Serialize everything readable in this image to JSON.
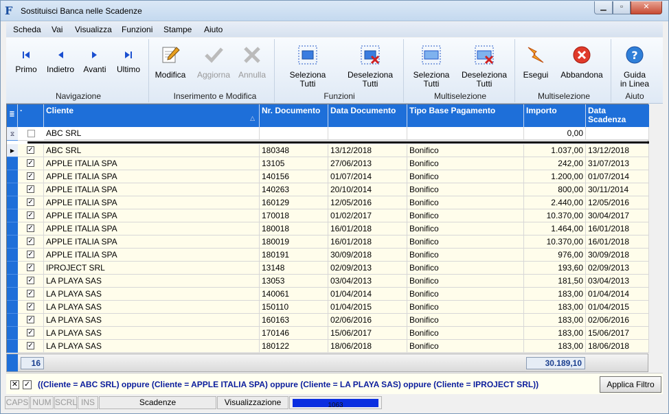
{
  "window": {
    "title": "Sostituisci Banca nelle Scadenze",
    "icon_letter": "F"
  },
  "menu": [
    "Scheda",
    "Vai",
    "Visualizza",
    "Funzioni",
    "Stampe",
    "Aiuto"
  ],
  "toolbar": {
    "nav": {
      "first": "Primo",
      "prev": "Indietro",
      "next": "Avanti",
      "last": "Ultimo",
      "group": "Navigazione"
    },
    "edit": {
      "modify": "Modifica",
      "update": "Aggiorna",
      "cancel": "Annulla",
      "group": "Inserimento e Modifica"
    },
    "funcs": {
      "select_all_1": "Seleziona",
      "select_all_2": "Tutti",
      "deselect_all_1": "Deseleziona",
      "deselect_all_2": "Tutti",
      "group": "Funzioni"
    },
    "multi": {
      "select_all_1": "Seleziona",
      "select_all_2": "Tutti",
      "deselect_all_1": "Deseleziona",
      "deselect_all_2": "Tutti",
      "group": "Multiselezione"
    },
    "exec": {
      "run": "Esegui",
      "abort": "Abbandona",
      "group": "Multiselezione"
    },
    "help": {
      "label_1": "Guida",
      "label_2": "in Linea",
      "group": "Aiuto"
    }
  },
  "grid": {
    "headers": {
      "check": "·",
      "cliente": "Cliente",
      "nr_doc": "Nr. Documento",
      "data_doc": "Data Documento",
      "tipo": "Tipo Base Pagamento",
      "importo": "Importo",
      "scadenza_1": "Data",
      "scadenza_2": "Scadenza"
    },
    "filter_row": {
      "cliente": "ABC SRL",
      "importo": "0,00"
    },
    "rows": [
      {
        "cliente": "ABC SRL",
        "nr": "180348",
        "data": "13/12/2018",
        "tipo": "Bonifico",
        "importo": "1.037,00",
        "scadenza": "13/12/2018"
      },
      {
        "cliente": "APPLE ITALIA SPA",
        "nr": "13105",
        "data": "27/06/2013",
        "tipo": "Bonifico",
        "importo": "242,00",
        "scadenza": "31/07/2013"
      },
      {
        "cliente": "APPLE ITALIA SPA",
        "nr": "140156",
        "data": "01/07/2014",
        "tipo": "Bonifico",
        "importo": "1.200,00",
        "scadenza": "01/07/2014"
      },
      {
        "cliente": "APPLE ITALIA SPA",
        "nr": "140263",
        "data": "20/10/2014",
        "tipo": "Bonifico",
        "importo": "800,00",
        "scadenza": "30/11/2014"
      },
      {
        "cliente": "APPLE ITALIA SPA",
        "nr": "160129",
        "data": "12/05/2016",
        "tipo": "Bonifico",
        "importo": "2.440,00",
        "scadenza": "12/05/2016"
      },
      {
        "cliente": "APPLE ITALIA SPA",
        "nr": "170018",
        "data": "01/02/2017",
        "tipo": "Bonifico",
        "importo": "10.370,00",
        "scadenza": "30/04/2017"
      },
      {
        "cliente": "APPLE ITALIA SPA",
        "nr": "180018",
        "data": "16/01/2018",
        "tipo": "Bonifico",
        "importo": "1.464,00",
        "scadenza": "16/01/2018"
      },
      {
        "cliente": "APPLE ITALIA SPA",
        "nr": "180019",
        "data": "16/01/2018",
        "tipo": "Bonifico",
        "importo": "10.370,00",
        "scadenza": "16/01/2018"
      },
      {
        "cliente": "APPLE ITALIA SPA",
        "nr": "180191",
        "data": "30/09/2018",
        "tipo": "Bonifico",
        "importo": "976,00",
        "scadenza": "30/09/2018"
      },
      {
        "cliente": "IPROJECT SRL",
        "nr": "13148",
        "data": "02/09/2013",
        "tipo": "Bonifico",
        "importo": "193,60",
        "scadenza": "02/09/2013"
      },
      {
        "cliente": "LA PLAYA SAS",
        "nr": "13053",
        "data": "03/04/2013",
        "tipo": "Bonifico",
        "importo": "181,50",
        "scadenza": "03/04/2013"
      },
      {
        "cliente": "LA PLAYA SAS",
        "nr": "140061",
        "data": "01/04/2014",
        "tipo": "Bonifico",
        "importo": "183,00",
        "scadenza": "01/04/2014"
      },
      {
        "cliente": "LA PLAYA SAS",
        "nr": "150110",
        "data": "01/04/2015",
        "tipo": "Bonifico",
        "importo": "183,00",
        "scadenza": "01/04/2015"
      },
      {
        "cliente": "LA PLAYA SAS",
        "nr": "160163",
        "data": "02/06/2016",
        "tipo": "Bonifico",
        "importo": "183,00",
        "scadenza": "02/06/2016"
      },
      {
        "cliente": "LA PLAYA SAS",
        "nr": "170146",
        "data": "15/06/2017",
        "tipo": "Bonifico",
        "importo": "183,00",
        "scadenza": "15/06/2017"
      },
      {
        "cliente": "LA PLAYA SAS",
        "nr": "180122",
        "data": "18/06/2018",
        "tipo": "Bonifico",
        "importo": "183,00",
        "scadenza": "18/06/2018"
      }
    ],
    "footer": {
      "count": "16",
      "total": "30.189,10"
    }
  },
  "filter": {
    "text": "((Cliente = ABC SRL) oppure (Cliente = APPLE ITALIA SPA) oppure (Cliente = LA PLAYA SAS) oppure (Cliente = IPROJECT SRL))",
    "apply": "Applica Filtro"
  },
  "status": {
    "caps": "CAPS",
    "num": "NUM",
    "scrl": "SCRL",
    "ins": "INS",
    "section": "Scadenze",
    "mode": "Visualizzazione",
    "progress": "1063"
  },
  "colors": {
    "accent": "#1e6fd9",
    "row_bg": "#fffdeb",
    "filter_text": "#0a1c9c"
  }
}
